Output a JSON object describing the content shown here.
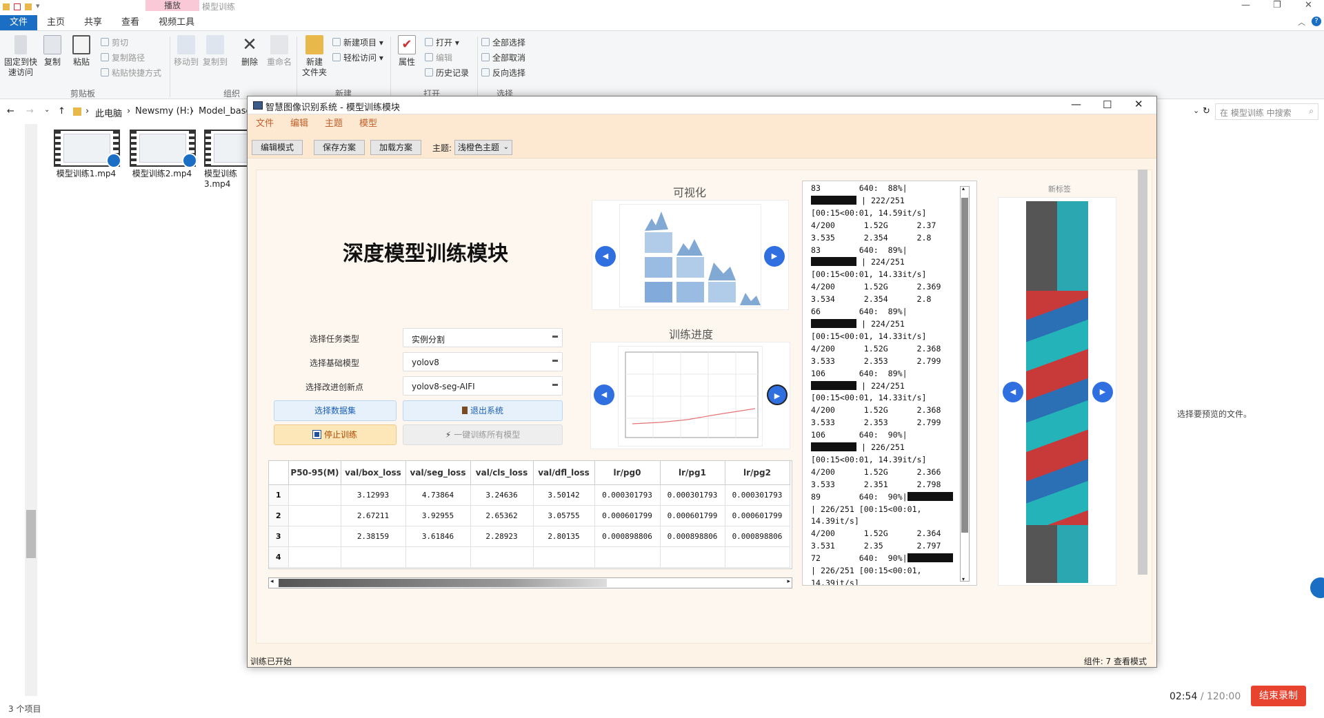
{
  "explorer": {
    "context_tab": "播放",
    "context_title": "模型训练",
    "tabs": [
      "文件",
      "主页",
      "共享",
      "查看",
      "视频工具"
    ],
    "ribbon": {
      "pin": "固定到快\n速访问",
      "copy": "复制",
      "paste": "粘贴",
      "cut": "剪切",
      "copy_path": "复制路径",
      "paste_shortcut": "粘贴快捷方式",
      "clipboard": "剪贴板",
      "move_to": "移动到",
      "copy_to": "复制到",
      "delete": "删除",
      "rename": "重命名",
      "organize": "组织",
      "new_folder": "新建\n文件夹",
      "new_item": "新建项目",
      "easy_access": "轻松访问",
      "new": "新建",
      "properties": "属性",
      "open": "打开",
      "edit": "编辑",
      "history": "历史记录",
      "open_group": "打开",
      "select_all": "全部选择",
      "select_none": "全部取消",
      "invert": "反向选择",
      "select": "选择"
    },
    "breadcrumb": [
      "此电脑",
      "Newsmy (H:)",
      "Model_base"
    ],
    "search_placeholder": "在 模型训练 中搜索",
    "files": [
      "模型训练1.mp4",
      "模型训练2.mp4",
      "模型训练3.mp4"
    ],
    "preview_msg": "选择要预览的文件。",
    "item_count": "3 个项目"
  },
  "recorder": {
    "elapsed": "02:54",
    "total": "/ 120:00",
    "stop_label": "结束录制"
  },
  "app": {
    "title": "智慧图像识别系统 - 模型训练模块",
    "menu": [
      "文件",
      "编辑",
      "主题",
      "模型"
    ],
    "toolbar": {
      "edit_mode": "编辑模式",
      "save_plan": "保存方案",
      "load_plan": "加载方案",
      "theme_label": "主题:",
      "theme_value": "浅橙色主题"
    },
    "heading": "深度模型训练模块",
    "viz_caption": "可视化",
    "progress_caption": "训练进度",
    "tag_title": "新标签",
    "form": {
      "task_label": "选择任务类型",
      "task_value": "实例分割",
      "base_label": "选择基础模型",
      "base_value": "yolov8",
      "improve_label": "选择改进创新点",
      "improve_value": "yolov8-seg-AIFI"
    },
    "buttons": {
      "dataset": "选择数据集",
      "exit": "退出系统",
      "stop": "停止训练",
      "train_all": "一键训练所有模型"
    },
    "table": {
      "columns": [
        "P50-95(M)",
        "val/box_loss",
        "val/seg_loss",
        "val/cls_loss",
        "val/dfl_loss",
        "lr/pg0",
        "lr/pg1",
        "lr/pg2"
      ],
      "rows": [
        {
          "n": "1",
          "cells": [
            "",
            "3.12993",
            "4.73864",
            "3.24636",
            "3.50142",
            "0.000301793",
            "0.000301793",
            "0.000301793"
          ]
        },
        {
          "n": "2",
          "cells": [
            "",
            "2.67211",
            "3.92955",
            "2.65362",
            "3.05755",
            "0.000601799",
            "0.000601799",
            "0.000601799"
          ]
        },
        {
          "n": "3",
          "cells": [
            "",
            "2.38159",
            "3.61846",
            "2.28923",
            "2.80135",
            "0.000898806",
            "0.000898806",
            "0.000898806"
          ]
        },
        {
          "n": "4",
          "cells": [
            "",
            "",
            "",
            "",
            "",
            "",
            "",
            ""
          ]
        }
      ]
    },
    "log_lines": [
      "83        640:  88%|",
      "[BLK] | 222/251",
      "[00:15<00:01, 14.59it/s]",
      "4/200      1.52G      2.37",
      "3.535      2.354      2.8",
      "83        640:  89%|",
      "[BLK] | 224/251",
      "[00:15<00:01, 14.33it/s]",
      "4/200      1.52G      2.369",
      "3.534      2.354      2.8",
      "66        640:  89%|",
      "[BLK] | 224/251",
      "[00:15<00:01, 14.33it/s]",
      "4/200      1.52G      2.368",
      "3.533      2.353      2.799",
      "106       640:  89%|",
      "[BLK] | 224/251",
      "[00:15<00:01, 14.33it/s]",
      "4/200      1.52G      2.368",
      "3.533      2.353      2.799",
      "106       640:  90%|",
      "[BLK] | 226/251",
      "[00:15<00:01, 14.39it/s]",
      "4/200      1.52G      2.366",
      "3.533      2.351      2.798",
      "89        640:  90%|[BLK]",
      "| 226/251 [00:15<00:01,",
      "14.39it/s]",
      "4/200      1.52G      2.364",
      "3.531      2.35       2.797",
      "72        640:  90%|[BLK]",
      "| 226/251 [00:15<00:01,",
      "14.39it/s]"
    ],
    "status_left": "训练已开始",
    "status_right": "组件: 7  查看模式"
  }
}
